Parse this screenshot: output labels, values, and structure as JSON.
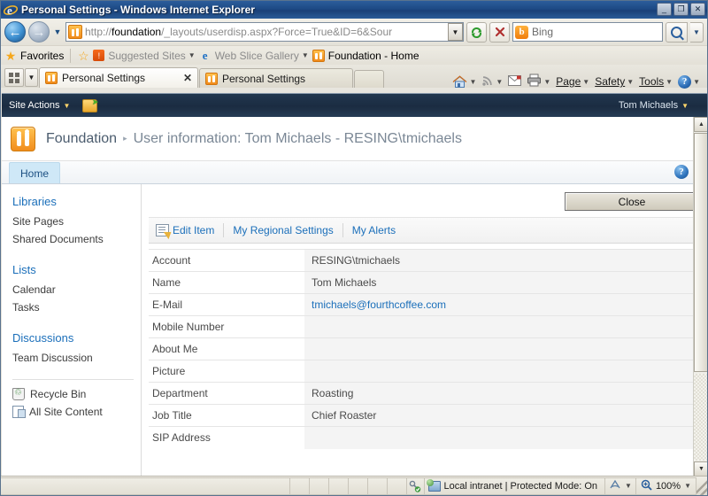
{
  "window": {
    "title": "Personal Settings - Windows Internet Explorer",
    "minimize_label": "_",
    "maximize_label": "❐",
    "close_label": "✕"
  },
  "navigation": {
    "back_icon": "back-arrow-icon",
    "forward_icon": "forward-arrow-icon",
    "history_caret": "▼",
    "address": {
      "scheme": "http://",
      "host": "foundation",
      "path": "/_layouts/userdisp.aspx?Force=True&ID=6&Sour",
      "full": "http://foundation/_layouts/userdisp.aspx?Force=True&ID=6&Sour",
      "dropdown_caret": "▼"
    },
    "refresh_label": "↻",
    "stop_label": "✕",
    "search": {
      "value": "Bing",
      "provider_icon_letter": "b",
      "go_icon": "search-icon",
      "dropdown_caret": "▼"
    }
  },
  "favorites_bar": {
    "favorites_label": "Favorites",
    "items": [
      {
        "label": "Suggested Sites",
        "caret": "▼"
      },
      {
        "label": "Web Slice Gallery",
        "caret": "▼"
      },
      {
        "label": "Foundation - Home",
        "caret": ""
      }
    ]
  },
  "tabs": {
    "quick_tabs_icon": "quick-tabs-icon",
    "tab_list_caret": "▼",
    "items": [
      {
        "label": "Personal Settings",
        "active": true,
        "close": "✕"
      },
      {
        "label": "Personal Settings",
        "active": false,
        "close": ""
      }
    ],
    "new_tab_label": ""
  },
  "command_bar": {
    "home_icon": "home-icon",
    "home_caret": "▼",
    "feeds_icon": "rss-icon",
    "feeds_caret": "▼",
    "mail_icon": "mail-icon",
    "print_icon": "print-icon",
    "print_caret": "▼",
    "items": [
      {
        "label": "Page",
        "caret": "▼"
      },
      {
        "label": "Safety",
        "caret": "▼"
      },
      {
        "label": "Tools",
        "caret": "▼"
      }
    ],
    "help_label": "?",
    "help_caret": "▼"
  },
  "sharepoint": {
    "site_actions": {
      "label": "Site Actions",
      "caret": "▼"
    },
    "navigate_up_icon": "navigate-up-icon",
    "welcome": {
      "user": "Tom Michaels",
      "caret": "▼"
    },
    "logo_icon": "sharepoint-logo-icon",
    "breadcrumb": {
      "site": "Foundation",
      "separator": "▸",
      "current": "User information: Tom Michaels - RESING\\tmichaels"
    },
    "ribbon_tabs": [
      {
        "label": "Home",
        "active": true
      }
    ],
    "help_label": "?",
    "quick_launch": {
      "groups": [
        {
          "heading": "Libraries",
          "links": [
            "Site Pages",
            "Shared Documents"
          ]
        },
        {
          "heading": "Lists",
          "links": [
            "Calendar",
            "Tasks"
          ]
        },
        {
          "heading": "Discussions",
          "links": [
            "Team Discussion"
          ]
        }
      ],
      "bottom_links": [
        {
          "label": "Recycle Bin",
          "icon": "recycle-bin-icon"
        },
        {
          "label": "All Site Content",
          "icon": "all-site-content-icon"
        }
      ]
    },
    "close_button": "Close",
    "toolbar": [
      {
        "label": "Edit Item",
        "icon": "edit-item-icon"
      },
      {
        "label": "My Regional Settings",
        "icon": ""
      },
      {
        "label": "My Alerts",
        "icon": ""
      }
    ],
    "user_info": [
      {
        "field": "Account",
        "value": "RESING\\tmichaels",
        "link": false
      },
      {
        "field": "Name",
        "value": "Tom Michaels",
        "link": false
      },
      {
        "field": "E-Mail",
        "value": "tmichaels@fourthcoffee.com",
        "link": true
      },
      {
        "field": "Mobile Number",
        "value": "",
        "link": false
      },
      {
        "field": "About Me",
        "value": "",
        "link": false
      },
      {
        "field": "Picture",
        "value": "",
        "link": false
      },
      {
        "field": "Department",
        "value": "Roasting",
        "link": false
      },
      {
        "field": "Job Title",
        "value": "Chief Roaster",
        "link": false
      },
      {
        "field": "SIP Address",
        "value": "",
        "link": false
      }
    ]
  },
  "status_bar": {
    "security_icon": "security-key-icon",
    "zone_icon": "intranet-icon",
    "zone_text": "Local intranet | Protected Mode: On",
    "compat_icon": "compatibility-view-icon",
    "compat_caret": "▼",
    "zoom_icon": "zoom-icon",
    "zoom_level": "100%",
    "zoom_caret": "▼"
  },
  "colors": {
    "titlebar": "#1d4a85",
    "sp_topbar": "#1b2c41",
    "accent_orange": "#f18d1d",
    "link_blue": "#1b6fba",
    "tab_active_blue": "#cfe8f7"
  }
}
